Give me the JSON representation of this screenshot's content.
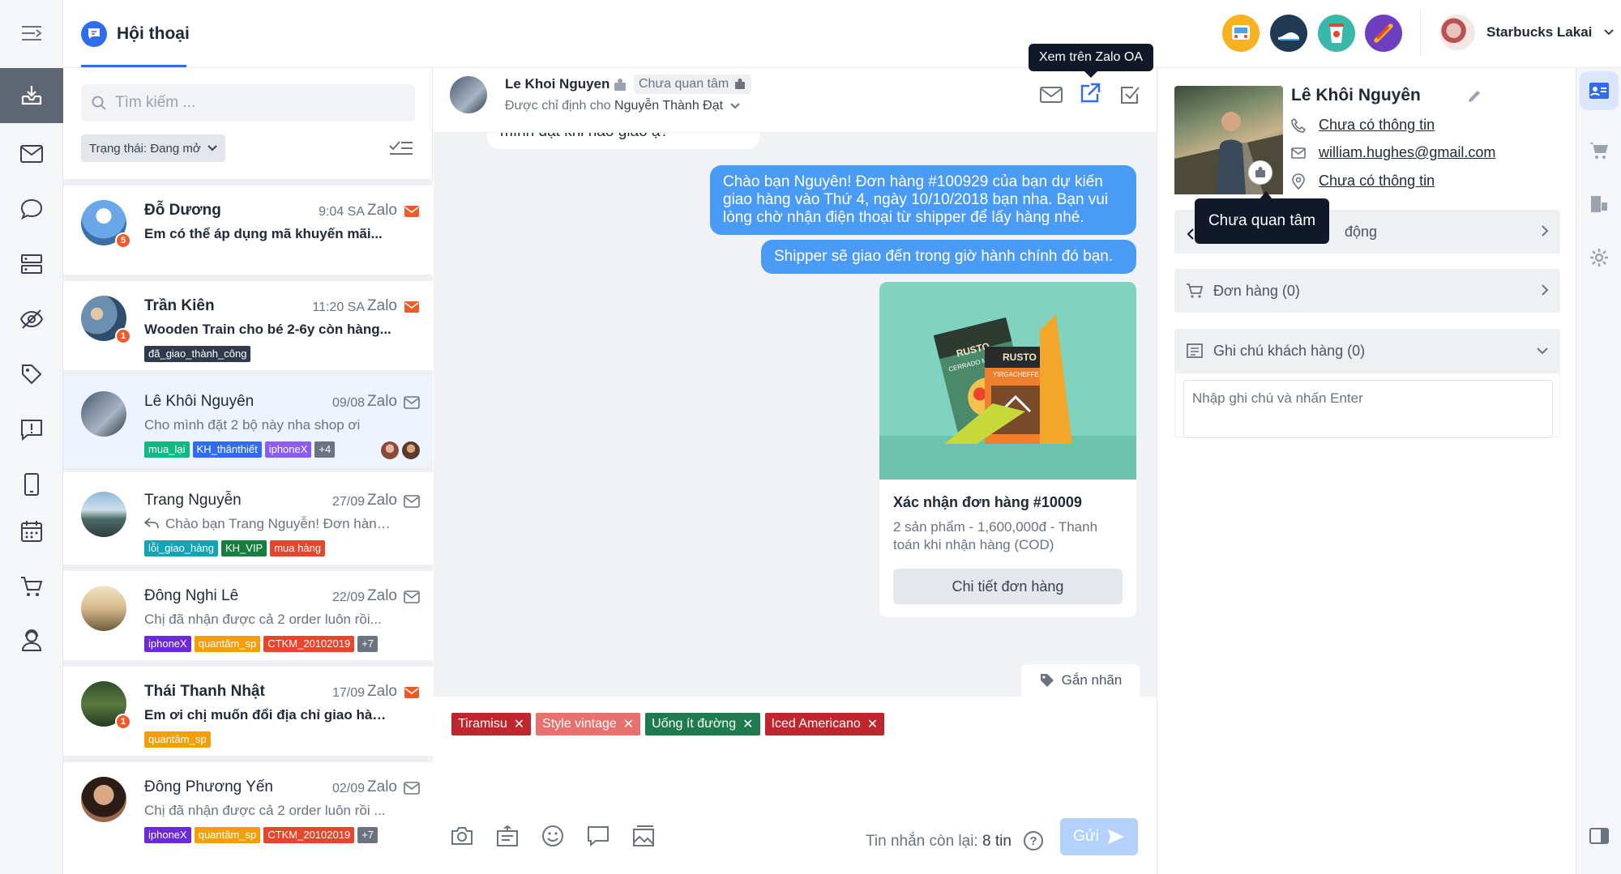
{
  "header": {
    "title": "Hội thoại",
    "tooltip_zalo": "Xem trên Zalo OA",
    "user_name": "Starbucks Lakai"
  },
  "search": {
    "placeholder": "Tìm kiếm ..."
  },
  "filter": {
    "label": "Trạng thái: Đang mở"
  },
  "conversations": [
    {
      "name": "Đỗ Dương",
      "time": "9:04 SA",
      "channel": "Zalo",
      "preview": "Em có thể áp dụng mã khuyến mãi...",
      "badge": "5",
      "unread": true,
      "tags": []
    },
    {
      "name": "Trần Kiên",
      "time": "11:20 SA",
      "channel": "Zalo",
      "preview": "Wooden Train cho bé 2-6y còn hàng...",
      "badge": "1",
      "unread": true,
      "tags": [
        {
          "label": "đã_giao_thành_công",
          "color": "#2f3b4c"
        }
      ]
    },
    {
      "name": "Lê Khôi Nguyên",
      "time": "09/08",
      "channel": "Zalo",
      "preview": "Cho mình đặt 2 bộ này nha shop ơi",
      "unread": false,
      "tags": [
        {
          "label": "mua_lại",
          "color": "#10b981"
        },
        {
          "label": "KH_thânthiết",
          "color": "#2f6ded"
        },
        {
          "label": "iphoneX",
          "color": "#8b5cf6"
        },
        {
          "label": "+4",
          "color": "#6b7280"
        }
      ]
    },
    {
      "name": "Trang Nguyễn",
      "time": "27/09",
      "channel": "Zalo",
      "preview": "Chào bạn Trang Nguyễn! Đơn hàng...",
      "unread": false,
      "tags": [
        {
          "label": "lỗi_giao_hàng",
          "color": "#0ea5b7"
        },
        {
          "label": "KH_VIP",
          "color": "#15803d"
        },
        {
          "label": "mua hàng",
          "color": "#e8452c"
        }
      ]
    },
    {
      "name": "Đông Nghi Lê",
      "time": "22/09",
      "channel": "Zalo",
      "preview": "Chị đã nhận được cả 2 order luôn rồi...",
      "unread": false,
      "tags": [
        {
          "label": "iphoneX",
          "color": "#6d28d9"
        },
        {
          "label": "quantâm_sp",
          "color": "#f59e0b"
        },
        {
          "label": "CTKM_20102019",
          "color": "#e8452c"
        },
        {
          "label": "+7",
          "color": "#6b7280"
        }
      ]
    },
    {
      "name": "Thái Thanh Nhật",
      "time": "17/09",
      "channel": "Zalo",
      "preview": "Em ơi chị muốn đổi địa chỉ giao hàng...",
      "badge": "1",
      "unread": true,
      "tags": [
        {
          "label": "quantâm_sp",
          "color": "#f59e0b"
        }
      ]
    },
    {
      "name": "Đông Phương Yến",
      "time": "02/09",
      "channel": "Zalo",
      "preview": "Chị đã nhận được cả 2 order luôn rồi ...",
      "unread": false,
      "tags": [
        {
          "label": "iphoneX",
          "color": "#6d28d9"
        },
        {
          "label": "quantâm_sp",
          "color": "#f59e0b"
        },
        {
          "label": "CTKM_20102019",
          "color": "#e8452c"
        },
        {
          "label": "+7",
          "color": "#6b7280"
        }
      ]
    }
  ],
  "chat": {
    "contact_name": "Le Khoi Nguyen",
    "status": "Chưa quan tâm",
    "assigned_prefix": "Được chỉ định cho",
    "assigned_to": "Nguyễn Thành Đạt",
    "messages": {
      "incoming": "mình đặt khi nào giao ạ?",
      "out1": "Chào bạn Nguyên! Đơn hàng #100929 của bạn dự kiến giao hàng vào Thứ 4, ngày 10/10/2018 bạn nha. Bạn vui lòng chờ nhận điện thoại từ shipper để lấy hàng nhé.",
      "out2": "Shipper sẽ giao đến trong giờ hành chính đó bạn."
    },
    "order_card": {
      "title": "Xác nhận đơn hàng #10009",
      "desc": "2 sản phẩm - 1,600,000đ - Thanh toán khi nhận hàng (COD)",
      "button": "Chi tiết đơn hàng",
      "product_brand": "RUSTO",
      "product_1": "CERRADO MITSUI",
      "product_2": "YIRGACHEFFE"
    },
    "tag_button": "Gắn nhãn",
    "composer_tags": [
      {
        "label": "Tiramisu",
        "color": "#c0262d"
      },
      {
        "label": "Style vintage",
        "color": "#e6716e"
      },
      {
        "label": "Uống ít đường",
        "color": "#1f7a4d"
      },
      {
        "label": "Iced Americano",
        "color": "#c0262d"
      }
    ],
    "remaining_label": "Tin nhắn còn lại:",
    "remaining_value": "8 tin",
    "send": "Gửi"
  },
  "profile": {
    "name": "Lê Khôi Nguyên",
    "phone": "Chưa có thông tin",
    "email": "william.hughes@gmail.com",
    "address": "Chưa có thông tin",
    "tooltip": "Chưa quan tâm",
    "activity_label": "động",
    "orders_label": "Đơn hàng (0)",
    "notes_label": "Ghi chú khách hàng (0)",
    "note_placeholder": "Nhập ghi chú và nhấn Enter"
  },
  "colors": {
    "accent": "#2f6ded",
    "bubble": "#4a9bf5",
    "unread": "#f05a28"
  }
}
